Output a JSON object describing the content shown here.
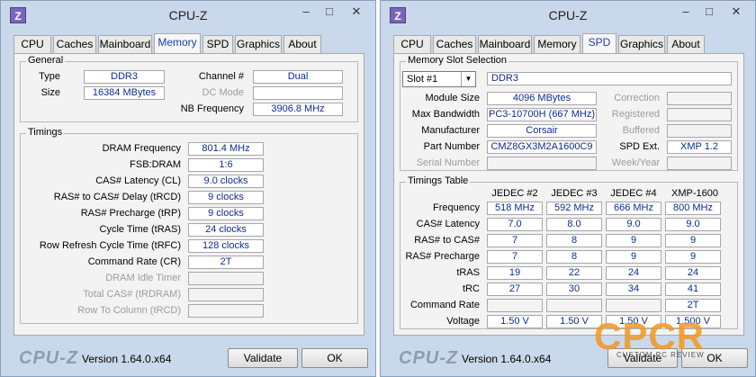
{
  "left_window": {
    "title": "CPU-Z",
    "tabs": [
      "CPU",
      "Caches",
      "Mainboard",
      "Memory",
      "SPD",
      "Graphics",
      "About"
    ],
    "active_tab": "Memory",
    "general": {
      "title": "General",
      "type_label": "Type",
      "type_value": "DDR3",
      "size_label": "Size",
      "size_value": "16384 MBytes",
      "channel_label": "Channel #",
      "channel_value": "Dual",
      "dc_mode_label": "DC Mode",
      "dc_mode_value": "",
      "nb_freq_label": "NB Frequency",
      "nb_freq_value": "3906.8 MHz"
    },
    "timings": {
      "title": "Timings",
      "rows": [
        {
          "label": "DRAM Frequency",
          "value": "801.4 MHz",
          "disabled": false
        },
        {
          "label": "FSB:DRAM",
          "value": "1:6",
          "disabled": false
        },
        {
          "label": "CAS# Latency (CL)",
          "value": "9.0 clocks",
          "disabled": false
        },
        {
          "label": "RAS# to CAS# Delay (tRCD)",
          "value": "9 clocks",
          "disabled": false
        },
        {
          "label": "RAS# Precharge (tRP)",
          "value": "9 clocks",
          "disabled": false
        },
        {
          "label": "Cycle Time (tRAS)",
          "value": "24 clocks",
          "disabled": false
        },
        {
          "label": "Row Refresh Cycle Time (tRFC)",
          "value": "128 clocks",
          "disabled": false
        },
        {
          "label": "Command Rate (CR)",
          "value": "2T",
          "disabled": false
        },
        {
          "label": "DRAM Idle Timer",
          "value": "",
          "disabled": true
        },
        {
          "label": "Total CAS# (tRDRAM)",
          "value": "",
          "disabled": true
        },
        {
          "label": "Row To Column (tRCD)",
          "value": "",
          "disabled": true
        }
      ]
    },
    "footer": {
      "brand": "CPU-Z",
      "version": "Version 1.64.0.x64",
      "validate": "Validate",
      "ok": "OK"
    }
  },
  "right_window": {
    "title": "CPU-Z",
    "tabs": [
      "CPU",
      "Caches",
      "Mainboard",
      "Memory",
      "SPD",
      "Graphics",
      "About"
    ],
    "active_tab": "SPD",
    "slot_section": {
      "title": "Memory Slot Selection",
      "slot_selected": "Slot #1",
      "mem_type": "DDR3",
      "module_size_label": "Module Size",
      "module_size_value": "4096 MBytes",
      "max_bw_label": "Max Bandwidth",
      "max_bw_value": "PC3-10700H (667 MHz)",
      "manufacturer_label": "Manufacturer",
      "manufacturer_value": "Corsair",
      "part_number_label": "Part Number",
      "part_number_value": "CMZ8GX3M2A1600C9",
      "serial_label": "Serial Number",
      "serial_value": "",
      "correction_label": "Correction",
      "registered_label": "Registered",
      "buffered_label": "Buffered",
      "spd_ext_label": "SPD Ext.",
      "spd_ext_value": "XMP 1.2",
      "week_year_label": "Week/Year"
    },
    "timings_table": {
      "title": "Timings Table",
      "columns": [
        "JEDEC #2",
        "JEDEC #3",
        "JEDEC #4",
        "XMP-1600"
      ],
      "rows": [
        {
          "label": "Frequency",
          "values": [
            "518 MHz",
            "592 MHz",
            "666 MHz",
            "800 MHz"
          ]
        },
        {
          "label": "CAS# Latency",
          "values": [
            "7.0",
            "8.0",
            "9.0",
            "9.0"
          ]
        },
        {
          "label": "RAS# to CAS#",
          "values": [
            "7",
            "8",
            "9",
            "9"
          ]
        },
        {
          "label": "RAS# Precharge",
          "values": [
            "7",
            "8",
            "9",
            "9"
          ]
        },
        {
          "label": "tRAS",
          "values": [
            "19",
            "22",
            "24",
            "24"
          ]
        },
        {
          "label": "tRC",
          "values": [
            "27",
            "30",
            "34",
            "41"
          ]
        },
        {
          "label": "Command Rate",
          "values": [
            "",
            "",
            "",
            "2T"
          ]
        },
        {
          "label": "Voltage",
          "values": [
            "1.50 V",
            "1.50 V",
            "1.50 V",
            "1.500 V"
          ]
        }
      ]
    },
    "footer": {
      "brand": "CPU-Z",
      "version": "Version 1.64.0.x64",
      "validate": "Validate",
      "ok": "OK"
    }
  },
  "watermark": {
    "text": "CPCR",
    "subtext": "CUSTOM PC REVIEW",
    "color": "#f3961e"
  },
  "colors": {
    "value_text": "#0b2e8e",
    "window_bg": "#c9d8ea",
    "panel_bg": "#f3f3f3"
  }
}
